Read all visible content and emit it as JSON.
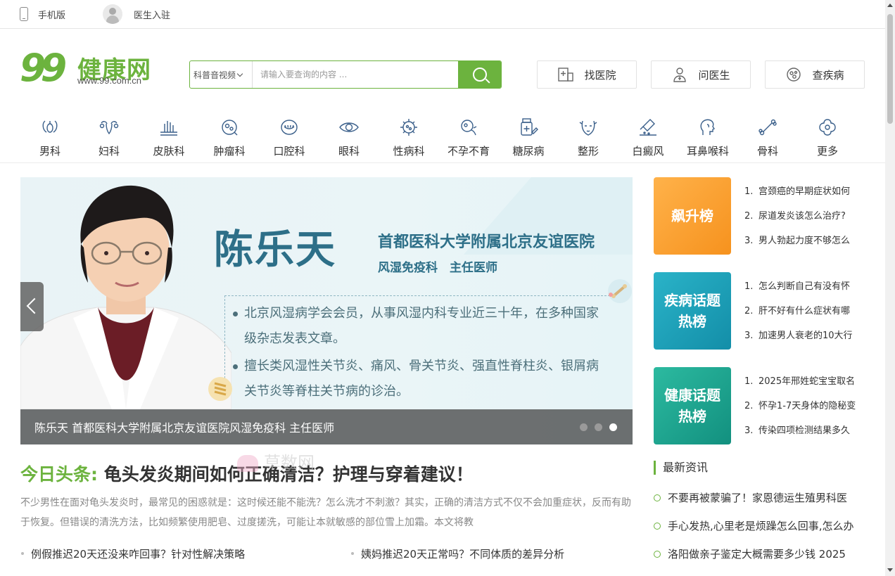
{
  "topbar": {
    "mobile": "手机版",
    "doctor_join": "医生入驻"
  },
  "logo": {
    "nines": "99",
    "brand": "健康网",
    "url": "www.99.com.cn"
  },
  "search": {
    "category": "科普音视频",
    "placeholder": "请输入要查询的内容 ..."
  },
  "header_buttons": [
    "找医院",
    "问医生",
    "查疾病"
  ],
  "departments": [
    "男科",
    "妇科",
    "皮肤科",
    "肿瘤科",
    "口腔科",
    "眼科",
    "性病科",
    "不孕不育",
    "糖尿病",
    "整形",
    "白癜风",
    "耳鼻喉科",
    "骨科",
    "更多"
  ],
  "banner": {
    "doctor_name": "陈乐天",
    "hospital": "首都医科大学附属北京友谊医院",
    "dept_title": "风湿免疫科　主任医师",
    "line1": "北京风湿病学会会员，从事风湿内科专业近三十年，在多种国家级杂志发表文章。",
    "line2": "擅长类风湿性关节炎、痛风、骨关节炎、强直性脊柱炎、银屑病关节炎等脊柱关节病的诊治。",
    "caption": "陈乐天 首都医科大学附属北京友谊医院风湿免疫科 主任医师",
    "slide_count": 3,
    "active_slide": 3
  },
  "headline": {
    "tag": "今日头条:",
    "title": "龟头发炎期间如何正确清洁？护理与穿着建议！"
  },
  "watermark": "草数网",
  "summary": "不少男性在面对龟头发炎时，最常见的困惑就是：这时候还能不能洗？怎么洗才不刺激？其实，正确的清洁方式不仅不会加重症状，反而有助于恢复。但错误的清洗方法，比如频繁使用肥皂、过度搓洗，可能让本就敏感的部位雪上加霜。本文将教",
  "related": [
    "例假推迟20天还没来咋回事？针对性解决策略",
    "姨妈推迟20天正常吗？不同体质的差异分析"
  ],
  "rankings": [
    {
      "title": [
        "飙升榜"
      ],
      "items": [
        "宫颈癌的早期症状如何",
        "尿道发炎该怎么治疗?",
        "男人勃起力度不够怎么"
      ]
    },
    {
      "title": [
        "疾病话题",
        "热榜"
      ],
      "items": [
        "怎么判断自己有没有怀",
        "肝不好有什么症状有哪",
        "加速男人衰老的10大行"
      ]
    },
    {
      "title": [
        "健康话题",
        "热榜"
      ],
      "items": [
        "2025年邢姓蛇宝宝取名",
        "怀孕1-7天身体的隐秘变",
        "传染四项检测结果多久"
      ]
    }
  ],
  "latest": {
    "heading": "最新资讯",
    "items": [
      "不要再被蒙骗了！家恩德运生殖男科医",
      "手心发热,心里老是烦躁怎么回事,怎么办",
      "洛阳做亲子鉴定大概需要多少钱 2025"
    ]
  },
  "colors": {
    "brand_green": "#6cb33e",
    "brand_orange": "#f39800",
    "banner_text": "#2d6f88"
  }
}
